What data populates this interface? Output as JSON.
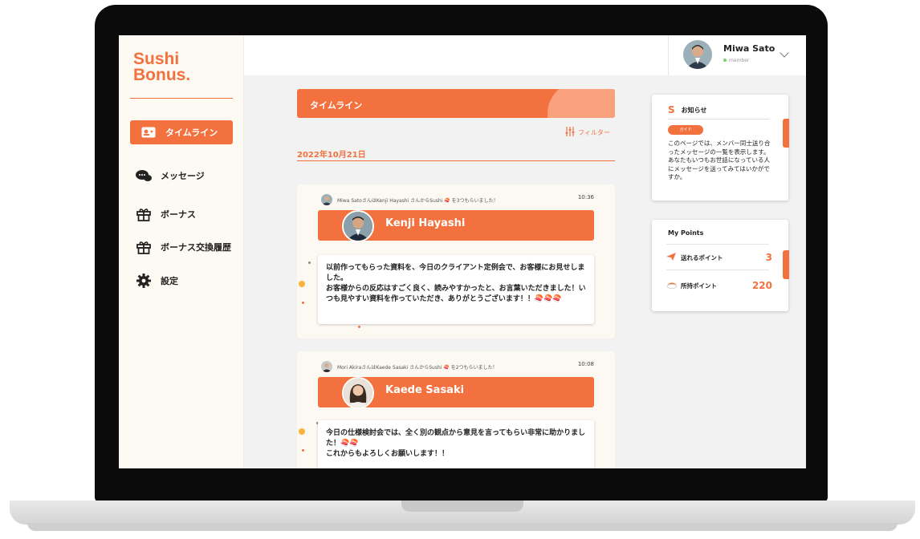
{
  "app": {
    "logo_line1": "Sushi",
    "logo_line2": "Bonus."
  },
  "sidebar": {
    "items": [
      {
        "label": "タイムライン",
        "icon": "timeline-icon",
        "active": true
      },
      {
        "label": "メッセージ",
        "icon": "message-icon"
      },
      {
        "label": "ボーナス",
        "icon": "gift-icon"
      },
      {
        "label": "ボーナス交換履歴",
        "icon": "gift-history-icon"
      },
      {
        "label": "設定",
        "icon": "gear-icon"
      }
    ]
  },
  "user": {
    "name": "Miwa Sato",
    "role": "member"
  },
  "timeline": {
    "header": "タイムライン",
    "filter_label": "フィルター",
    "date": "2022年10月21日",
    "posts": [
      {
        "meta": "Miwa SatoさんはKenji Hayashi さんからSushi 🍣 を3つもらいました！",
        "time": "10:36",
        "recipient": "Kenji Hayashi",
        "message": "以前作ってもらった資料を、今日のクライアント定例会で、お客様にお見せしました。\nお客様からの反応はすごく良く、読みやすかったと、お言葉いただきました！いつも見やすい資料を作っていただき、ありがとうございます！！🍣🍣🍣"
      },
      {
        "meta": "Mori AkiraさんはKaede Sasaki さんからSushi 🍣 を2つもらいました！",
        "time": "10:08",
        "recipient": "Kaede Sasaki",
        "message": "今日の仕様検討会では、全く別の観点から意見を言ってもらい非常に助かりました！🍣🍣\nこれからもよろしくお願いします！！"
      }
    ]
  },
  "notice": {
    "badge": "S",
    "title": "お知らせ",
    "tag": "ガイド",
    "text": "このページでは、メンバー同士送り合ったメッセージの一覧を表示します。あなたもいつもお世話になっている人にメッセージを送ってみてはいかがですか。"
  },
  "points": {
    "title": "My Points",
    "sendable_label": "送れるポイント",
    "sendable_value": "3",
    "owned_label": "所持ポイント",
    "owned_value": "220"
  },
  "colors": {
    "accent": "#f2713e",
    "sidebar_bg": "#fdf9f3"
  }
}
